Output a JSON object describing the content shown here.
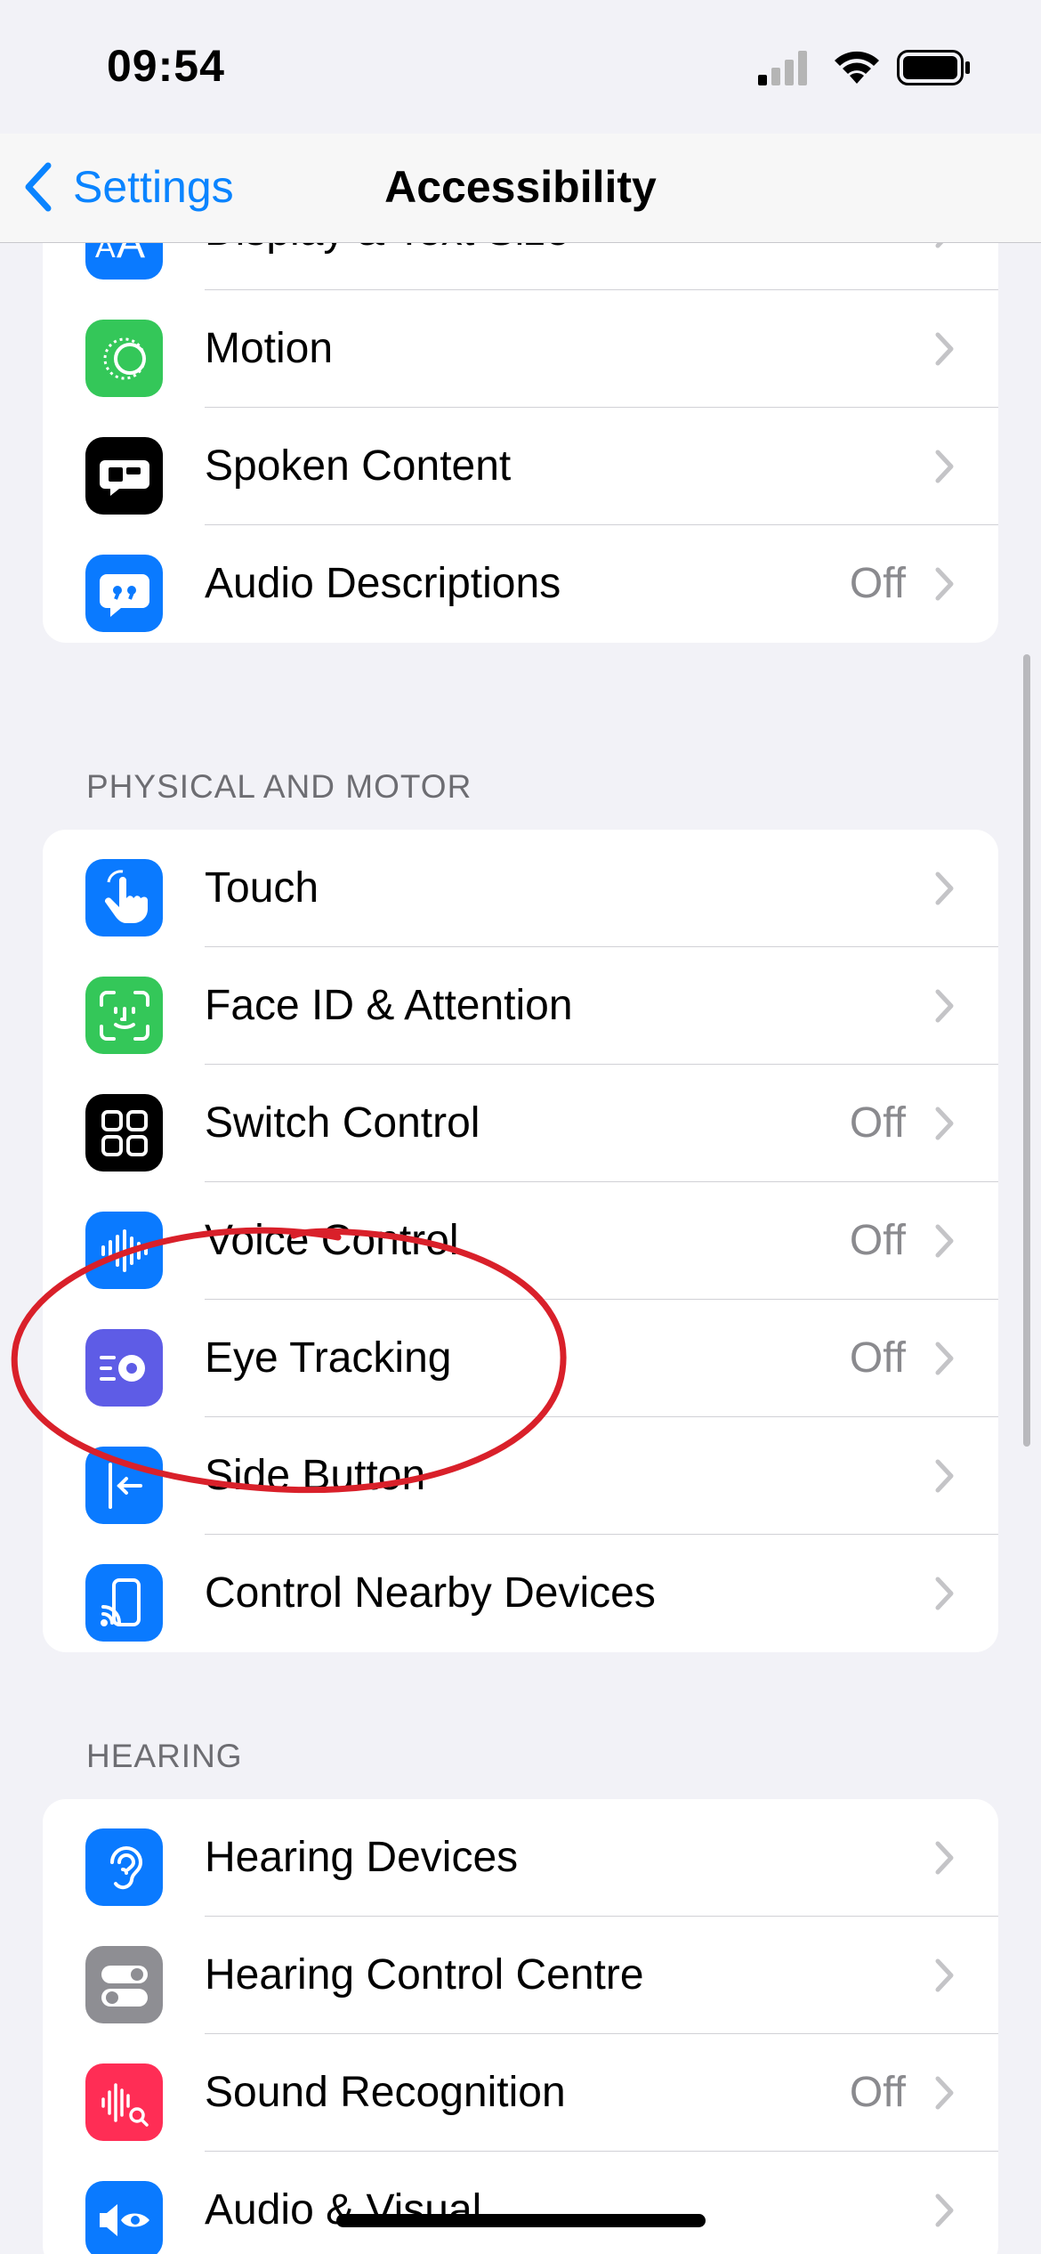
{
  "status": {
    "time": "09:54"
  },
  "nav": {
    "back_label": "Settings",
    "title": "Accessibility"
  },
  "vision_group": {
    "items": [
      {
        "label": "Display & Text Size",
        "value": "",
        "icon": "text-size-icon",
        "color": "#0a7aff"
      },
      {
        "label": "Motion",
        "value": "",
        "icon": "motion-icon",
        "color": "#34c759"
      },
      {
        "label": "Spoken Content",
        "value": "",
        "icon": "spoken-content-icon",
        "color": "#000000"
      },
      {
        "label": "Audio Descriptions",
        "value": "Off",
        "icon": "audio-descriptions-icon",
        "color": "#0a7aff"
      }
    ]
  },
  "physical_group": {
    "header": "PHYSICAL AND MOTOR",
    "items": [
      {
        "label": "Touch",
        "value": "",
        "icon": "touch-icon",
        "color": "#0a7aff"
      },
      {
        "label": "Face ID & Attention",
        "value": "",
        "icon": "face-id-icon",
        "color": "#34c759"
      },
      {
        "label": "Switch Control",
        "value": "Off",
        "icon": "switch-control-icon",
        "color": "#000000"
      },
      {
        "label": "Voice Control",
        "value": "Off",
        "icon": "voice-control-icon",
        "color": "#0a7aff"
      },
      {
        "label": "Eye Tracking",
        "value": "Off",
        "icon": "eye-tracking-icon",
        "color": "#5e5ce6"
      },
      {
        "label": "Side Button",
        "value": "",
        "icon": "side-button-icon",
        "color": "#0a7aff"
      },
      {
        "label": "Control Nearby Devices",
        "value": "",
        "icon": "control-nearby-devices-icon",
        "color": "#0a7aff"
      }
    ]
  },
  "hearing_group": {
    "header": "HEARING",
    "items": [
      {
        "label": "Hearing Devices",
        "value": "",
        "icon": "ear-icon",
        "color": "#0a7aff"
      },
      {
        "label": "Hearing Control Centre",
        "value": "",
        "icon": "toggles-icon",
        "color": "#8e8e93"
      },
      {
        "label": "Sound Recognition",
        "value": "Off",
        "icon": "sound-recognition-icon",
        "color": "#ff2d55"
      },
      {
        "label": "Audio & Visual",
        "value": "",
        "icon": "audio-visual-icon",
        "color": "#0a7aff"
      }
    ]
  },
  "annotation": {
    "color": "#d9202a"
  }
}
